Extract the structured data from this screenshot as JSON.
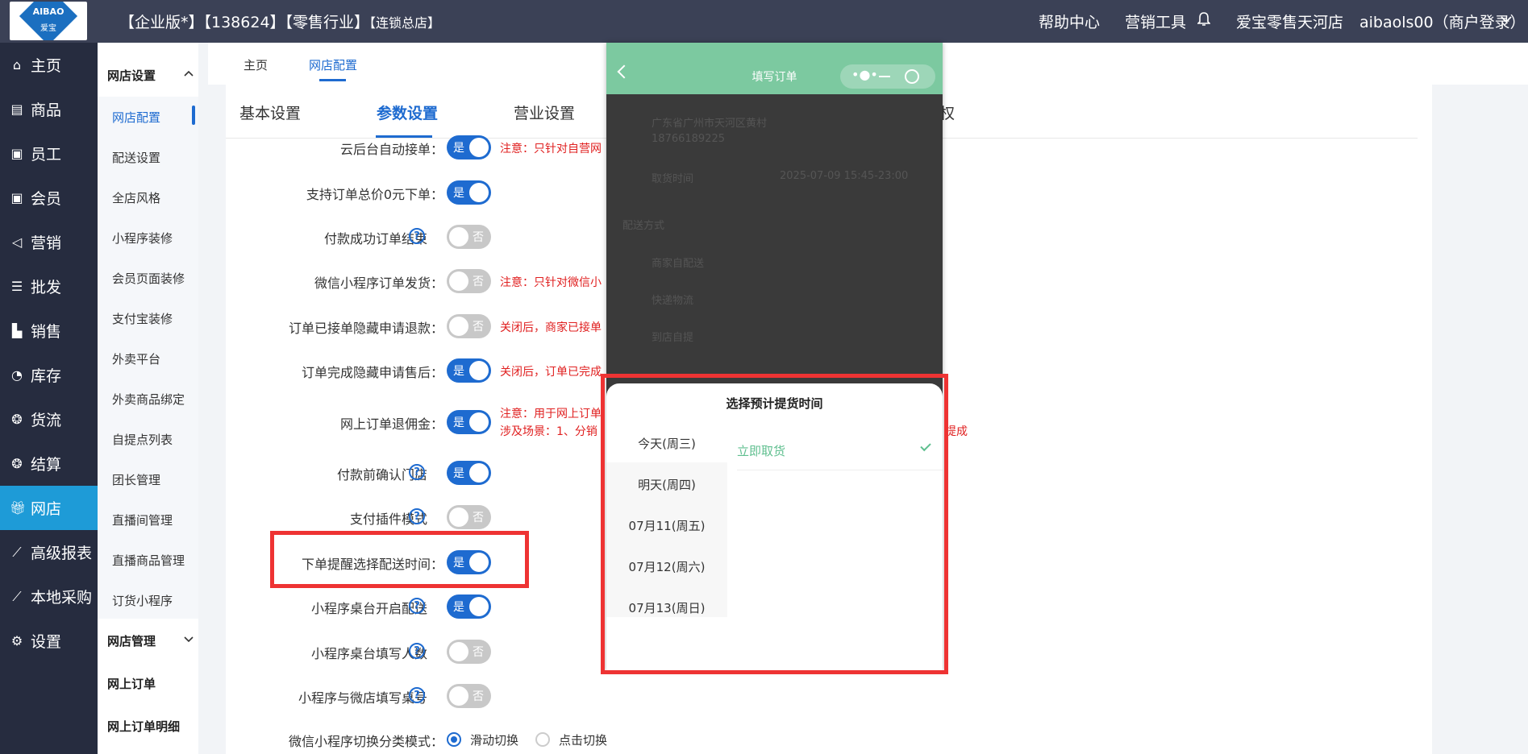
{
  "header": {
    "logo_text_top": "AIBAO",
    "logo_text_bottom": "爱宝",
    "edition": "【企业版*】【138624】【零售行业】",
    "store_type": "【连锁总店】",
    "help": "帮助中心",
    "marketing_tools": "营销工具",
    "store_name": "爱宝零售天河店",
    "user": "aibaols00（商户登录）"
  },
  "leftnav": [
    {
      "label": "主页",
      "icon": "home-icon"
    },
    {
      "label": "商品",
      "icon": "goods-icon"
    },
    {
      "label": "员工",
      "icon": "staff-icon"
    },
    {
      "label": "会员",
      "icon": "member-icon"
    },
    {
      "label": "营销",
      "icon": "megaphone-icon"
    },
    {
      "label": "批发",
      "icon": "list-icon"
    },
    {
      "label": "销售",
      "icon": "bar-chart-icon"
    },
    {
      "label": "库存",
      "icon": "pie-icon"
    },
    {
      "label": "货流",
      "icon": "flow-icon"
    },
    {
      "label": "结算",
      "icon": "settle-icon"
    },
    {
      "label": "网店",
      "icon": "gift-icon"
    },
    {
      "label": "高级报表",
      "icon": "line-chart-icon"
    },
    {
      "label": "本地采购",
      "icon": "trend-icon"
    },
    {
      "label": "设置",
      "icon": "gear-icon"
    }
  ],
  "subnav": {
    "section1": "网店设置",
    "items": [
      "网店配置",
      "配送设置",
      "全店风格",
      "小程序装修",
      "会员页面装修",
      "支付宝装修",
      "外卖平台",
      "外卖商品绑定",
      "自提点列表",
      "团长管理",
      "直播间管理",
      "直播商品管理",
      "订货小程序"
    ],
    "section2": "网店管理",
    "items2": [
      "网上订单",
      "网上订单明细"
    ]
  },
  "tabs": [
    "主页",
    "网店配置"
  ],
  "subtabs": [
    "基本设置",
    "参数设置",
    "营业设置",
    "权"
  ],
  "settings": [
    {
      "label": "云后台自动接单：",
      "state": "是",
      "note": "注意：只针对自营网"
    },
    {
      "label": "支持订单总价0元下单：",
      "state": "是",
      "note": ""
    },
    {
      "label": "付款成功订单结束",
      "state": "否",
      "note": "",
      "help": true
    },
    {
      "label": "微信小程序订单发货：",
      "state": "否",
      "note": "注意：只针对微信小"
    },
    {
      "label": "订单已接单隐藏申请退款：",
      "state": "否",
      "note": "关闭后，商家已接单"
    },
    {
      "label": "订单完成隐藏申请售后：",
      "state": "是",
      "note": "关闭后，订单已完成"
    },
    {
      "label": "网上订单退佣金：",
      "state": "是",
      "note": "注意：用于网上订单",
      "note2": "涉及场景：1、分销",
      "note3": "提成"
    },
    {
      "label": "付款前确认门店",
      "state": "是",
      "note": "",
      "help": true
    },
    {
      "label": "支付插件模式",
      "state": "否",
      "note": "",
      "help": true
    },
    {
      "label": "下单提醒选择配送时间：",
      "state": "是",
      "note": ""
    },
    {
      "label": "小程序桌台开启配送",
      "state": "是",
      "note": "",
      "help": true
    },
    {
      "label": "小程序桌台填写人数",
      "state": "否",
      "note": "",
      "help": true
    },
    {
      "label": "小程序与微店填写桌号",
      "state": "否",
      "note": "",
      "help": true
    }
  ],
  "category_mode": {
    "label": "微信小程序切换分类模式：",
    "option1": "滑动切换",
    "option2": "点击切换"
  },
  "phone": {
    "title": "填写订单",
    "address": "广东省广州市天河区黄村",
    "phone_number": "18766189225",
    "pickup_label": "取货时间",
    "pickup_value": "2025-07-09 15:45-23:00",
    "delivery_title": "配送方式",
    "delivery_options": [
      "商家自配送",
      "快递物流",
      "到店自提"
    ],
    "sheet_title": "选择预计提货时间",
    "days": [
      "今天(周三)",
      "明天(周四)",
      "07月11(周五)",
      "07月12(周六)",
      "07月13(周日)"
    ],
    "slot": "立即取货"
  },
  "colors": {
    "accent": "#1e6bd0",
    "nav_bg": "#262c3f",
    "top_bg": "#3b4156",
    "highlight": "#ee3333",
    "mini_green": "#7cc9a0"
  }
}
